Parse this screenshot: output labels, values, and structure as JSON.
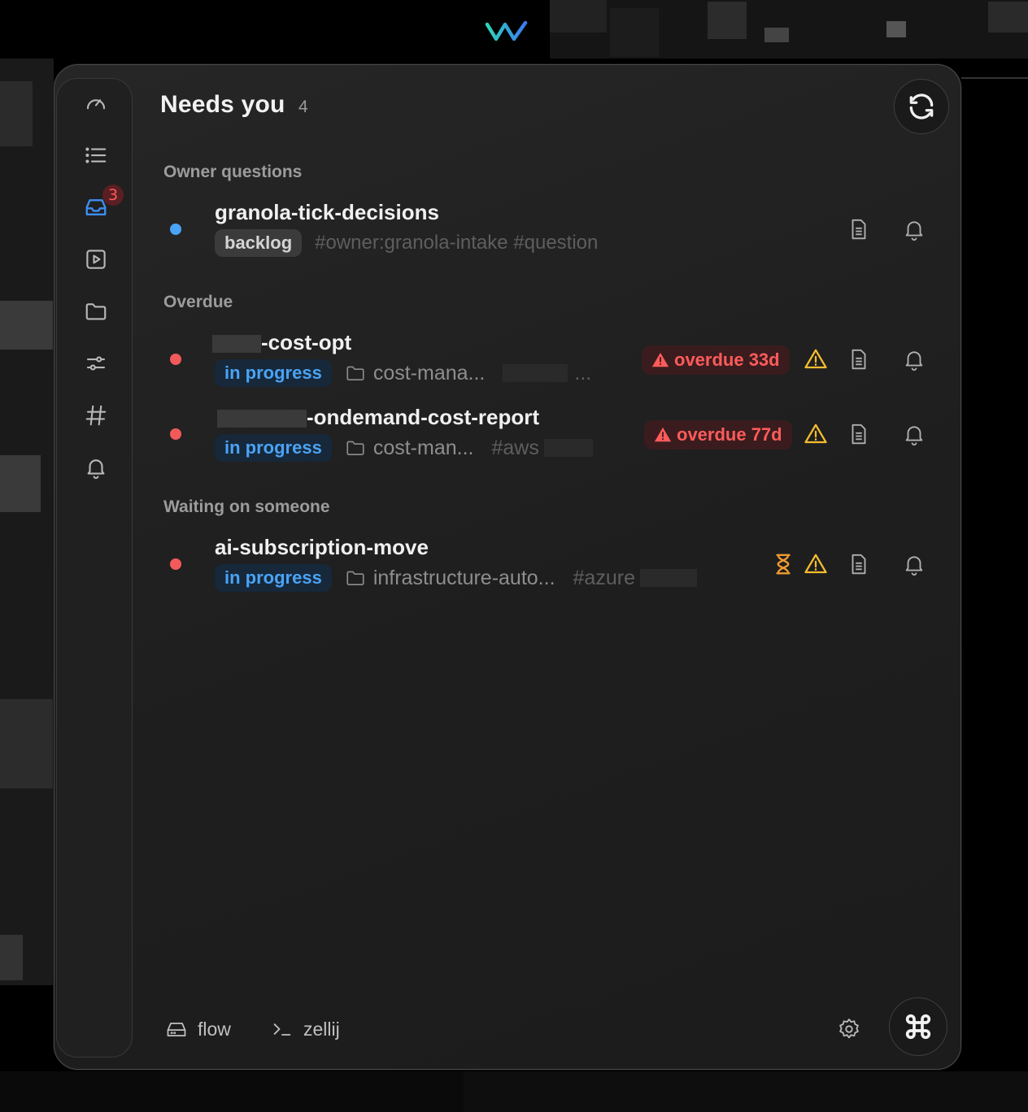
{
  "header": {
    "title": "Needs you",
    "count": "4"
  },
  "sidebar": {
    "inbox_badge": "3"
  },
  "sections": [
    {
      "title": "Owner questions"
    },
    {
      "title": "Overdue"
    },
    {
      "title": "Waiting on someone"
    }
  ],
  "items": [
    {
      "title": "granola-tick-decisions",
      "status": "backlog",
      "tags": "#owner:granola-intake #question",
      "dot_color": "#4aa3f5"
    },
    {
      "title": "-cost-opt",
      "status": "in progress",
      "folder": "cost-mana...",
      "trailing": "...",
      "overdue": "overdue 33d",
      "dot_color": "#f25a5a"
    },
    {
      "title": "-ondemand-cost-report",
      "status": "in progress",
      "folder": "cost-man...",
      "tag": "#aws",
      "overdue": "overdue 77d",
      "dot_color": "#f25a5a"
    },
    {
      "title": "ai-subscription-move",
      "status": "in progress",
      "folder": "infrastructure-auto...",
      "tag": "#azure",
      "dot_color": "#f25a5a"
    }
  ],
  "footer": {
    "workspace": "flow",
    "terminal": "zellij"
  }
}
